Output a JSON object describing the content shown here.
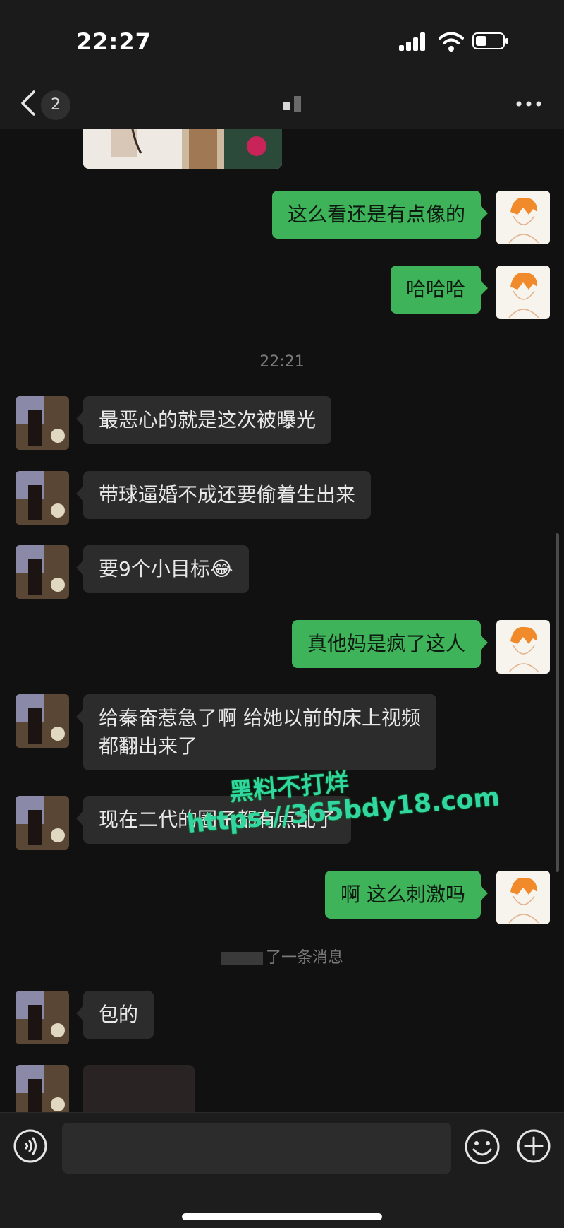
{
  "status": {
    "time": "22:27"
  },
  "nav": {
    "badge": "2",
    "title_blurred": "▪ ▪"
  },
  "messages": [
    {
      "side": "out",
      "text": "这么看还是有点像的"
    },
    {
      "side": "out",
      "text": "哈哈哈"
    },
    {
      "timestamp": "22:21"
    },
    {
      "side": "in",
      "text": "最恶心的就是这次被曝光"
    },
    {
      "side": "in",
      "text": "带球逼婚不成还要偷着生出来"
    },
    {
      "side": "in",
      "text": "要9个小目标😂"
    },
    {
      "side": "out",
      "text": "真他妈是疯了这人"
    },
    {
      "side": "in",
      "text_line1": "给秦奋惹急了啊 给她以前的床上视频",
      "text_line2": "都翻出来了"
    },
    {
      "side": "in",
      "text": "现在二代的圈子都有点乱了"
    },
    {
      "side": "out",
      "text": "啊 这么刺激吗"
    },
    {
      "recall": "了一条消息"
    },
    {
      "side": "in",
      "text": "包的"
    }
  ],
  "watermark": {
    "line1": "黑料不打烊",
    "line2": "https://365bdy18.com"
  },
  "colors": {
    "outgoing": "#3eb35a",
    "incoming": "#2c2c2c",
    "background": "#111111"
  },
  "icons": [
    "back-icon",
    "more-icon",
    "voice-icon",
    "emoji-icon",
    "plus-icon"
  ]
}
